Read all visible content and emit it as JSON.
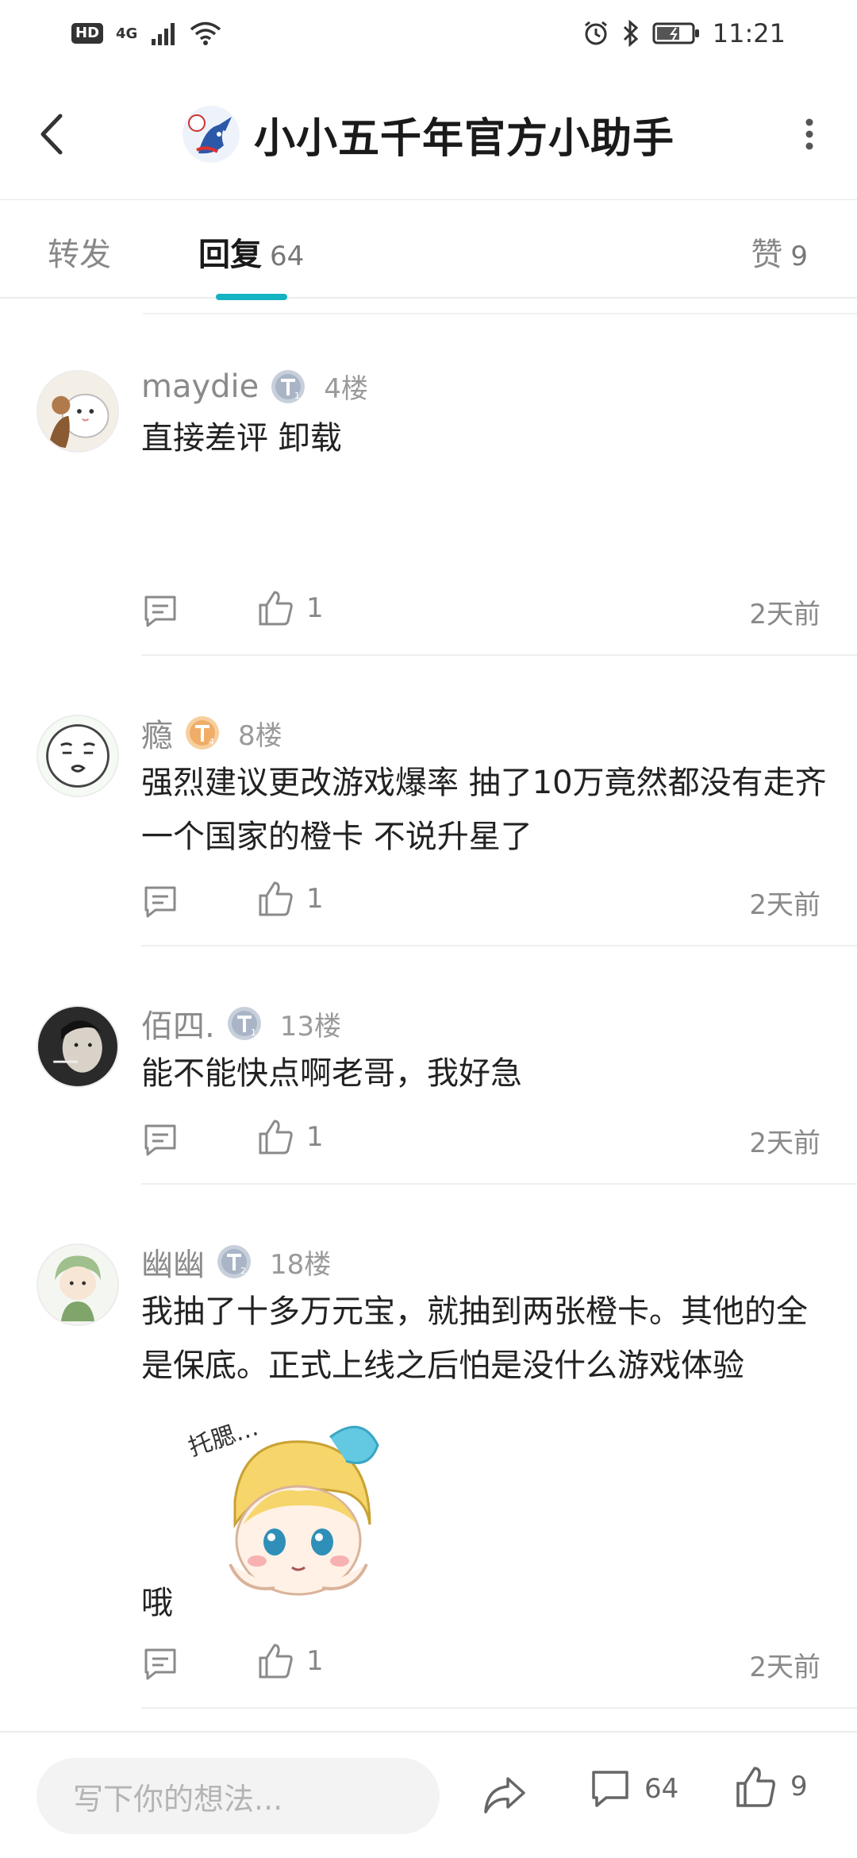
{
  "status_bar": {
    "hd": "HD",
    "network": "4G",
    "time": "11:21"
  },
  "header": {
    "title": "小小五千年官方小助手"
  },
  "tabs": {
    "forward": {
      "label": "转发"
    },
    "reply": {
      "label": "回复",
      "count": "64"
    },
    "like": {
      "label": "赞",
      "count": "9"
    }
  },
  "comments": [
    {
      "username": "maydie",
      "level": "T1",
      "floor": "4楼",
      "text": "直接差评 卸载",
      "likes": "1",
      "time": "2天前"
    },
    {
      "username": "瘾",
      "level": "T4",
      "floor": "8楼",
      "text": "强烈建议更改游戏爆率 抽了10万竟然都没有走齐一个国家的橙卡 不说升星了",
      "likes": "1",
      "time": "2天前"
    },
    {
      "username": "佰四.",
      "level": "T1",
      "floor": "13楼",
      "text": "能不能快点啊老哥，我好急",
      "likes": "1",
      "time": "2天前"
    },
    {
      "username": "幽幽",
      "level": "T2",
      "floor": "18楼",
      "text": "我抽了十多万元宝，就抽到两张橙卡。其他的全是保底。正式上线之后怕是没什么游戏体验",
      "tail": "哦",
      "sticker_text": "托腮…",
      "likes": "1",
      "time": "2天前"
    }
  ],
  "bottom_bar": {
    "placeholder": "写下你的想法...",
    "comment_count": "64",
    "like_count": "9"
  },
  "colors": {
    "accent": "#14b3c2",
    "badge_silver": "#b9c3d1",
    "badge_orange": "#f2b87a"
  }
}
